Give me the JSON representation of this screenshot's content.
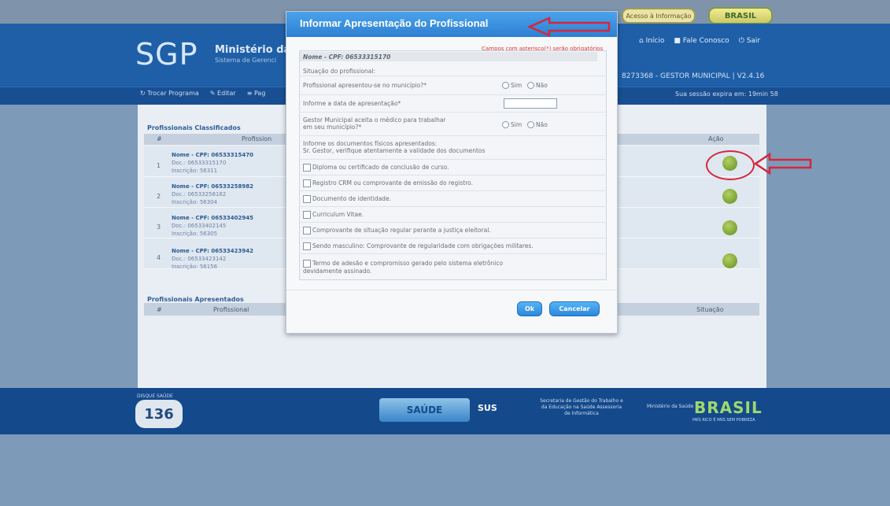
{
  "top": {
    "info_pill": "Acesso à Informação",
    "brasil_pill": "BRASIL"
  },
  "header": {
    "logo": "SGP",
    "ministry": "Ministério da",
    "ministry_sub": "Sistema de Gerenci",
    "links": {
      "inicio": "Início",
      "fale": "Fale Conosco",
      "sair": "Sair"
    },
    "user_line": "8273368 - GESTOR MUNICIPAL | V2.4.16"
  },
  "menu": {
    "items": [
      "Trocar Programa",
      "Editar",
      "Pag"
    ],
    "session": "Sua sessão expira em: 19min 58"
  },
  "section1": {
    "title": "Profissionais Classificados",
    "col_num": "#",
    "col_prof": "Profission",
    "col_acao": "Ação",
    "rows": [
      {
        "num": "1",
        "nome": "Nome - CPF: 06533315470",
        "doc": "Doc.: 06533315170",
        "insc": "Inscrição: 56311"
      },
      {
        "num": "2",
        "nome": "Nome - CPF: 06533258982",
        "doc": "Doc.: 06533258182",
        "insc": "Inscrição: 56304"
      },
      {
        "num": "3",
        "nome": "Nome - CPF: 06533402945",
        "doc": "Doc.: 06533402145",
        "insc": "Inscrição: 56305"
      },
      {
        "num": "4",
        "nome": "Nome - CPF: 06533423942",
        "doc": "Doc.: 06533423142",
        "insc": "Inscrição: 56156"
      }
    ]
  },
  "section2": {
    "title": "Profissionais Apresentados",
    "col_num": "#",
    "col_prof": "Profissional",
    "col_sit": "Situação"
  },
  "footer": {
    "hotline_label": "DISQUE SAÚDE",
    "hotline": "136",
    "saude_logo": "SAÚDE",
    "sus_logo": "SUS",
    "secretaria": "Secretaria de Gestão do Trabalho e da Educação na Saúde Assessoria de Informática",
    "ministerio": "Ministério da Saúde",
    "brasil": "BRASIL",
    "brasil_tag": "PAÍS RICO É PAÍS SEM POBREZA"
  },
  "modal": {
    "title": "Informar Apresentação do Profissional",
    "required_note": "Campos com asterisco(*) serão obrigatórios",
    "nome": "Nome - CPF: 06533315170",
    "situacao": "Situação do profissional:",
    "q1": "Profissional apresentou-se no município?*",
    "q2": "Informe a data de apresentação*",
    "q3_line1": "Gestor Municipal aceita o médico para trabalhar",
    "q3_line2": "em seu município?*",
    "sim": "Sim",
    "nao": "Não",
    "date_value": "",
    "docs_line1": "Informe os documentos físicos apresentados:",
    "docs_line2": "Sr. Gestor, verifique atentamente a validade dos documentos",
    "checks": [
      "Diploma ou certificado de conclusão de curso.",
      "Registro CRM ou comprovante de emissão do registro.",
      "Documento de identidade.",
      "Curriculum Vitae.",
      "Comprovante de situação regular perante a justiça eleitoral.",
      "Sendo masculino: Comprovante de regularidade com obrigações militares."
    ],
    "check7_line1": "Termo de adesão e compromisso gerado pelo sistema eletrônico",
    "check7_line2": "devidamente assinado.",
    "ok": "Ok",
    "cancel": "Cancelar"
  },
  "colors": {
    "header": "#1f5fa7",
    "modal_title": "#2e7fd1",
    "annotation_red": "#d5273a",
    "action_green": "#6f9c2a"
  }
}
